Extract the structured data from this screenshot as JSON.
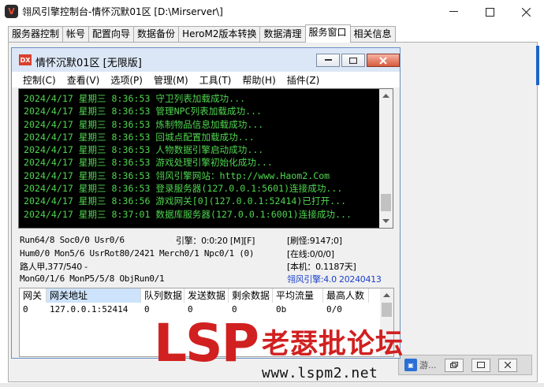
{
  "window": {
    "title": "翎风引擎控制台-情怀沉默01区 [D:\\Mirserver\\]",
    "logo_letter": "V"
  },
  "tabs": [
    {
      "label": "服务器控制"
    },
    {
      "label": "帐号"
    },
    {
      "label": "配置向导"
    },
    {
      "label": "数据备份"
    },
    {
      "label": "HeroM2版本转换"
    },
    {
      "label": "数据清理"
    },
    {
      "label": "服务窗口"
    },
    {
      "label": "相关信息"
    }
  ],
  "active_tab_index": 6,
  "inner_window": {
    "title": "情怀沉默01区 [无限版]",
    "logo_letter": "DX",
    "menu": [
      "控制(C)",
      "查看(V)",
      "选项(P)",
      "管理(M)",
      "工具(T)",
      "帮助(H)",
      "插件(Z)"
    ]
  },
  "console": {
    "lines": [
      "2024/4/17 星期三 8:36:53 守卫列表加载成功...",
      "2024/4/17 星期三 8:36:53 管理NPC列表加载成功...",
      "2024/4/17 星期三 8:36:53 炼制物品信息加载成功...",
      "2024/4/17 星期三 8:36:53 回城点配置加载成功...",
      "2024/4/17 星期三 8:36:53 人物数据引擎启动成功...",
      "2024/4/17 星期三 8:36:53 游戏处理引擎初始化成功...",
      "2024/4/17 星期三 8:36:53 翎风引擎网站：http://www.Haom2.Com",
      "2024/4/17 星期三 8:36:53 登录服务器(127.0.0.1:5601)连接成功...",
      "2024/4/17 星期三 8:36:56 游戏网关[0](127.0.0.1:52414)已打开...",
      "2024/4/17 星期三 8:37:01 数据库服务器(127.0.0.1:6001)连接成功..."
    ]
  },
  "status": {
    "run": "Run64/8 Soc0/0 Usr0/6",
    "engine_time": "引擎：0:0:20 [M][F]",
    "refresh": "[刷怪:9147;0]",
    "hum": "Hum0/0 Mon5/6 UsrRot80/2421 Merch0/1 Npc0/1 (0)",
    "online": "[在线:0/0/0]",
    "path": "路人甲,377/540 -",
    "local": "[本机：0.1187天]",
    "mongo": "MonG0/1/6 MonP5/5/8 ObjRun0/1",
    "version": "翎风引擎:4.0 20240413"
  },
  "gateway_table": {
    "columns": [
      "网关",
      "网关地址",
      "队列数据",
      "发送数据",
      "剩余数据",
      "平均流量",
      "最高人数"
    ],
    "rows": [
      [
        "0",
        "127.0.0.1:52414",
        "0",
        "0",
        "0",
        "0b",
        "0/0"
      ]
    ]
  },
  "taskbar_strip": {
    "label": "游..."
  },
  "watermark": {
    "big": "LSP",
    "cn": "老瑟批论坛",
    "url": "www.lspm2.net"
  }
}
